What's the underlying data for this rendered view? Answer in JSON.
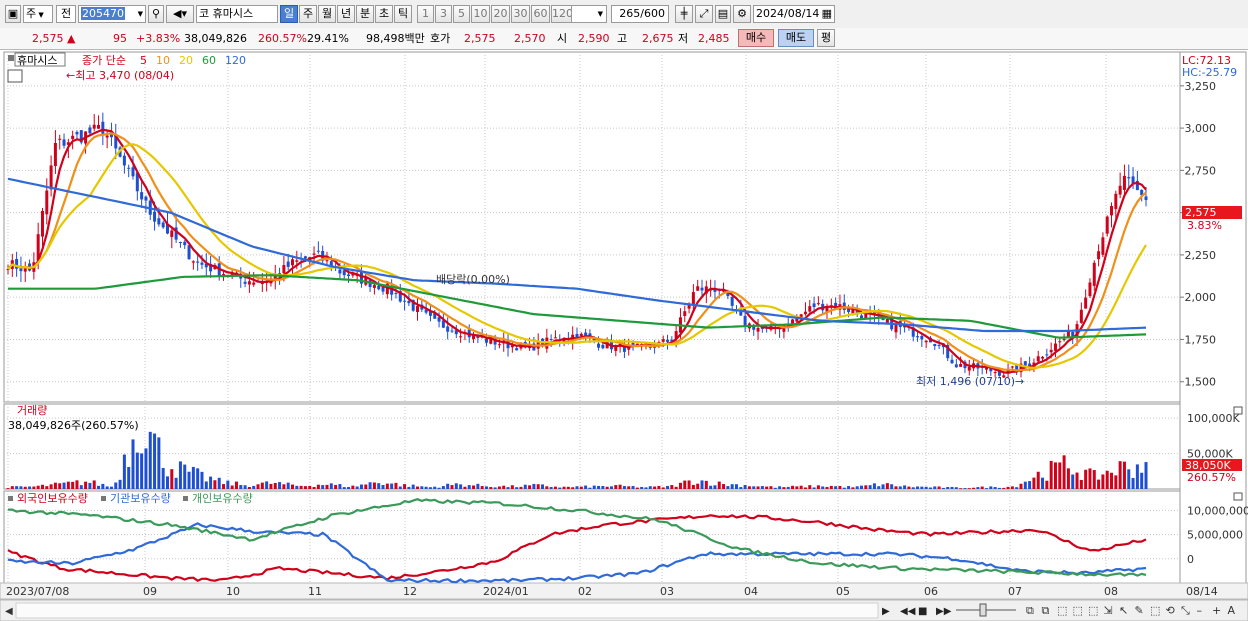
{
  "toolbar": {
    "market": "주",
    "prev_label": "전",
    "code": "205470",
    "stock_name": "휴마시스",
    "code_prefix": "코",
    "periods": [
      "일",
      "주",
      "월",
      "년",
      "분",
      "초",
      "틱"
    ],
    "selected_period": "일",
    "intervals": [
      "1",
      "3",
      "5",
      "10",
      "20",
      "30",
      "60",
      "120"
    ],
    "count": "265",
    "count_total": "/600",
    "date": "2024/08/14"
  },
  "quote": {
    "price": "2,575",
    "arrow": "▲",
    "change": "95",
    "change_pct": "+3.83%",
    "volume": "38,049,826",
    "volume_ratio": "260.57%",
    "turnover": "29.41%",
    "amount": "98,498백만",
    "bid_label": "호가",
    "ask": "2,575",
    "bid": "2,570",
    "open_label": "시",
    "open": "2,590",
    "high_label": "고",
    "high": "2,675",
    "low_label": "저",
    "low": "2,485",
    "buy_label": "매수",
    "sell_label": "매도",
    "avg_label": "평"
  },
  "legend": {
    "stock_name": "휴마시스",
    "close_label": "종가 단순",
    "ma": [
      {
        "period": "5",
        "color": "#d0021b"
      },
      {
        "period": "10",
        "color": "#f0901a"
      },
      {
        "period": "20",
        "color": "#e6c800"
      },
      {
        "period": "60",
        "color": "#1e9a3a"
      },
      {
        "period": "120",
        "color": "#2f6ad8"
      }
    ],
    "lc": "LC:72.13",
    "hc": "HC:-25.79",
    "high_mark": "최고 3,470 (08/04)",
    "low_mark": "최저 1,496 (07/10)",
    "ex_dividend": "배당락(0.00%)",
    "last_price": "2,575",
    "last_pct": "3.83%"
  },
  "volume_panel": {
    "title": "거래량",
    "info": "38,049,826주(260.57%)",
    "axis_ticks": [
      "100,000K",
      "50,000K"
    ],
    "last_value": "38,050K",
    "last_pct": "260.57%",
    "colors": {
      "up": "#d0021b",
      "down": "#1f4fd1"
    }
  },
  "holding_panel": {
    "series": [
      {
        "name": "외국인보유수량",
        "color": "#d0021b"
      },
      {
        "name": "기관보유수량",
        "color": "#2f6ad8"
      },
      {
        "name": "개인보유수량",
        "color": "#3a9a5a"
      }
    ],
    "axis_ticks": [
      "10,000,000",
      "5,000,000",
      "0"
    ]
  },
  "x_axis_labels": [
    "2023/07/08",
    "09",
    "10",
    "11",
    "12",
    "2024/01",
    "02",
    "03",
    "04",
    "05",
    "06",
    "07",
    "08",
    "08/14"
  ],
  "chart_data": [
    {
      "type": "candlestick",
      "title": "휴마시스",
      "ylim": [
        1380,
        3450
      ],
      "yticks": [
        1500,
        1750,
        2000,
        2250,
        2500,
        2750,
        3000,
        3250
      ],
      "months": [
        "2023/07",
        "09",
        "10",
        "11",
        "12",
        "2024/01",
        "02",
        "03",
        "04",
        "05",
        "06",
        "07",
        "08"
      ],
      "close_approx": [
        2200,
        2150,
        2900,
        2950,
        3000,
        2750,
        2500,
        2350,
        2200,
        2150,
        2100,
        2100,
        2200,
        2250,
        2150,
        2100,
        2050,
        1950,
        1850,
        1800,
        1750,
        1720,
        1700,
        1750,
        1780,
        1720,
        1700,
        1700,
        1750,
        2050,
        2050,
        1850,
        1800,
        1850,
        1950,
        1950,
        1900,
        1850,
        1800,
        1750,
        1600,
        1580,
        1550,
        1600,
        1700,
        1800,
        2300,
        2700,
        2575
      ],
      "ma120_approx": [
        2700,
        2600,
        2500,
        2300,
        2180,
        2100,
        2080,
        2050,
        1980,
        1920,
        1860,
        1840,
        1800,
        1800,
        1820
      ],
      "ma60_approx": [
        2050,
        2050,
        2120,
        2130,
        2100,
        2000,
        1900,
        1860,
        1820,
        1840,
        1880,
        1860,
        1760,
        1780
      ]
    },
    {
      "type": "bar",
      "title": "거래량",
      "unit": "K",
      "ylim": [
        0,
        120000
      ],
      "values_approx": [
        3000,
        4000,
        8000,
        12000,
        3000,
        118000,
        40000,
        25000,
        12000,
        6000,
        10000,
        5000,
        8000,
        4000,
        12000,
        6000,
        3000,
        8000,
        5000,
        4000,
        6000,
        3000,
        4000,
        5000,
        3000,
        4000,
        15000,
        8000,
        6000,
        3000,
        4000,
        5000,
        3000,
        8000,
        4000,
        3000,
        2000,
        3000,
        4000,
        25000,
        40000,
        20000,
        35000,
        38050
      ]
    },
    {
      "type": "line",
      "title": "보유수량",
      "ylim": [
        -5000000,
        14000000
      ],
      "series": [
        {
          "name": "외국인보유수량",
          "values_approx": [
            1500000,
            -2000000,
            -3000000,
            -4000000,
            -4500000,
            -2000000,
            -3000000,
            -4000000,
            -2500000,
            -500000,
            5000000,
            7000000,
            8000000,
            9000000,
            8500000,
            7500000,
            6000000,
            5000000,
            5500000,
            6000000,
            1500000,
            4000000
          ]
        },
        {
          "name": "기관보유수량",
          "values_approx": [
            -500000,
            -1000000,
            2000000,
            7000000,
            5500000,
            5000000,
            -4500000,
            -4500000,
            -4500000,
            -4000000,
            -3000000,
            1000000,
            1000000,
            1000000,
            1000000,
            0,
            -2500000,
            -3000000,
            -2000000
          ]
        },
        {
          "name": "개인보유수량",
          "values_approx": [
            10000000,
            9000000,
            7000000,
            4000000,
            9000000,
            12000000,
            11500000,
            10000000,
            8000000,
            2000000,
            -1000000,
            -2000000,
            -2500000,
            -3000000,
            -3500000
          ]
        }
      ]
    }
  ]
}
